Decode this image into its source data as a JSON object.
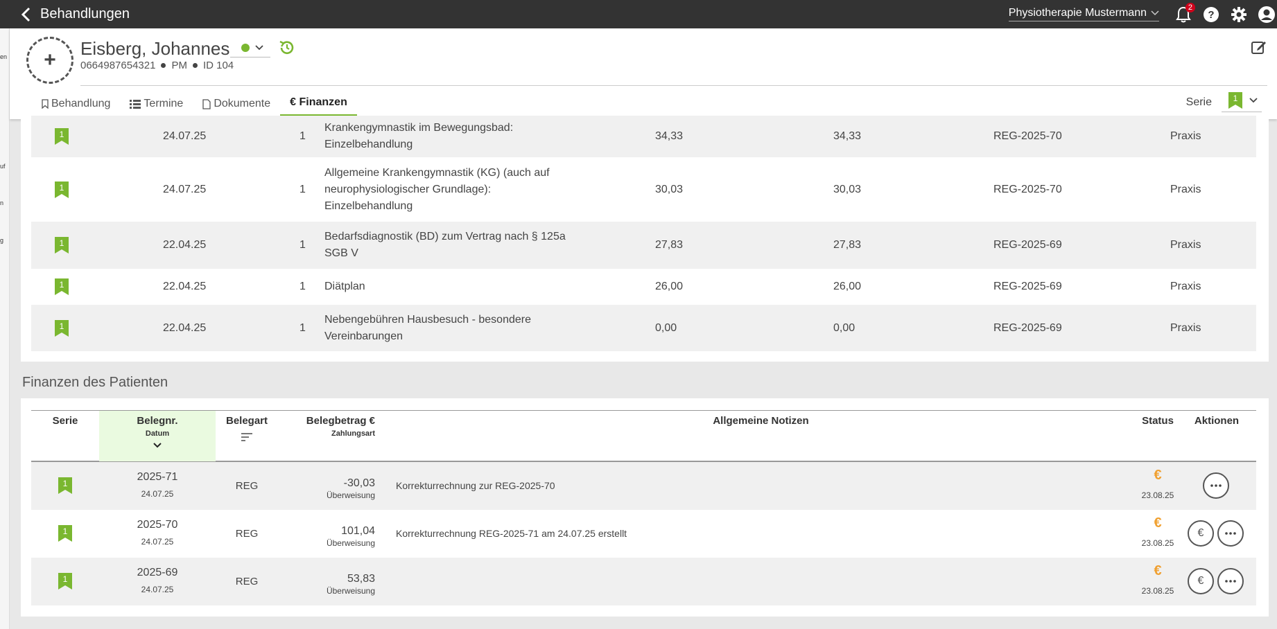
{
  "topbar": {
    "title": "Behandlungen",
    "practice": "Physiotherapie Mustermann",
    "notification_count": "2"
  },
  "leftstrip": [
    "en",
    "uf",
    "n",
    "g"
  ],
  "patient": {
    "name": "Eisberg, Johannes",
    "phone": "0664987654321",
    "initials": "PM",
    "id": "ID 104"
  },
  "tabs": [
    {
      "label": "Behandlung"
    },
    {
      "label": "Termine"
    },
    {
      "label": "Dokumente"
    },
    {
      "label": "€ Finanzen"
    }
  ],
  "serie": {
    "label": "Serie",
    "value": "1"
  },
  "treatments": [
    {
      "serie": "1",
      "date": "24.07.25",
      "qty": "1",
      "desc": [
        "Krankengymnastik im Bewegungsbad:",
        "Einzelbehandlung"
      ],
      "price": "34,33",
      "total": "34,33",
      "invoice": "REG-2025-70",
      "place": "Praxis"
    },
    {
      "serie": "1",
      "date": "24.07.25",
      "qty": "1",
      "desc": [
        "Allgemeine Krankengymnastik (KG) (auch auf",
        "neurophysiologischer Grundlage):",
        "Einzelbehandlung"
      ],
      "price": "30,03",
      "total": "30,03",
      "invoice": "REG-2025-70",
      "place": "Praxis"
    },
    {
      "serie": "1",
      "date": "22.04.25",
      "qty": "1",
      "desc": [
        "Bedarfsdiagnostik (BD) zum Vertrag nach § 125a",
        "SGB V"
      ],
      "price": "27,83",
      "total": "27,83",
      "invoice": "REG-2025-69",
      "place": "Praxis"
    },
    {
      "serie": "1",
      "date": "22.04.25",
      "qty": "1",
      "desc": [
        "Diätplan"
      ],
      "price": "26,00",
      "total": "26,00",
      "invoice": "REG-2025-69",
      "place": "Praxis"
    },
    {
      "serie": "1",
      "date": "22.04.25",
      "qty": "1",
      "desc": [
        "Nebengebühren Hausbesuch - besondere",
        "Vereinbarungen"
      ],
      "price": "0,00",
      "total": "0,00",
      "invoice": "REG-2025-69",
      "place": "Praxis"
    }
  ],
  "finances": {
    "section_title": "Finanzen des Patienten",
    "headers": {
      "serie": "Serie",
      "belegnr": "Belegnr.",
      "datum": "Datum",
      "belegart": "Belegart",
      "betrag": "Belegbetrag €",
      "zahlungsart": "Zahlungsart",
      "notizen": "Allgemeine Notizen",
      "status": "Status",
      "aktionen": "Aktionen"
    },
    "rows": [
      {
        "serie": "1",
        "nr": "2025-71",
        "date": "24.07.25",
        "type": "REG",
        "amount": "-30,03",
        "payment": "Überweisung",
        "note": "Korrekturrechnung zur REG-2025-70",
        "status_date": "23.08.25"
      },
      {
        "serie": "1",
        "nr": "2025-70",
        "date": "24.07.25",
        "type": "REG",
        "amount": "101,04",
        "payment": "Überweisung",
        "note": "Korrekturrechnung REG-2025-71 am 24.07.25 erstellt",
        "status_date": "23.08.25"
      },
      {
        "serie": "1",
        "nr": "2025-69",
        "date": "24.07.25",
        "type": "REG",
        "amount": "53,83",
        "payment": "Überweisung",
        "note": "",
        "status_date": "23.08.25"
      }
    ]
  },
  "colors": {
    "accent": "#7ab730",
    "topbar": "#333333",
    "euro": "#f0a030"
  }
}
